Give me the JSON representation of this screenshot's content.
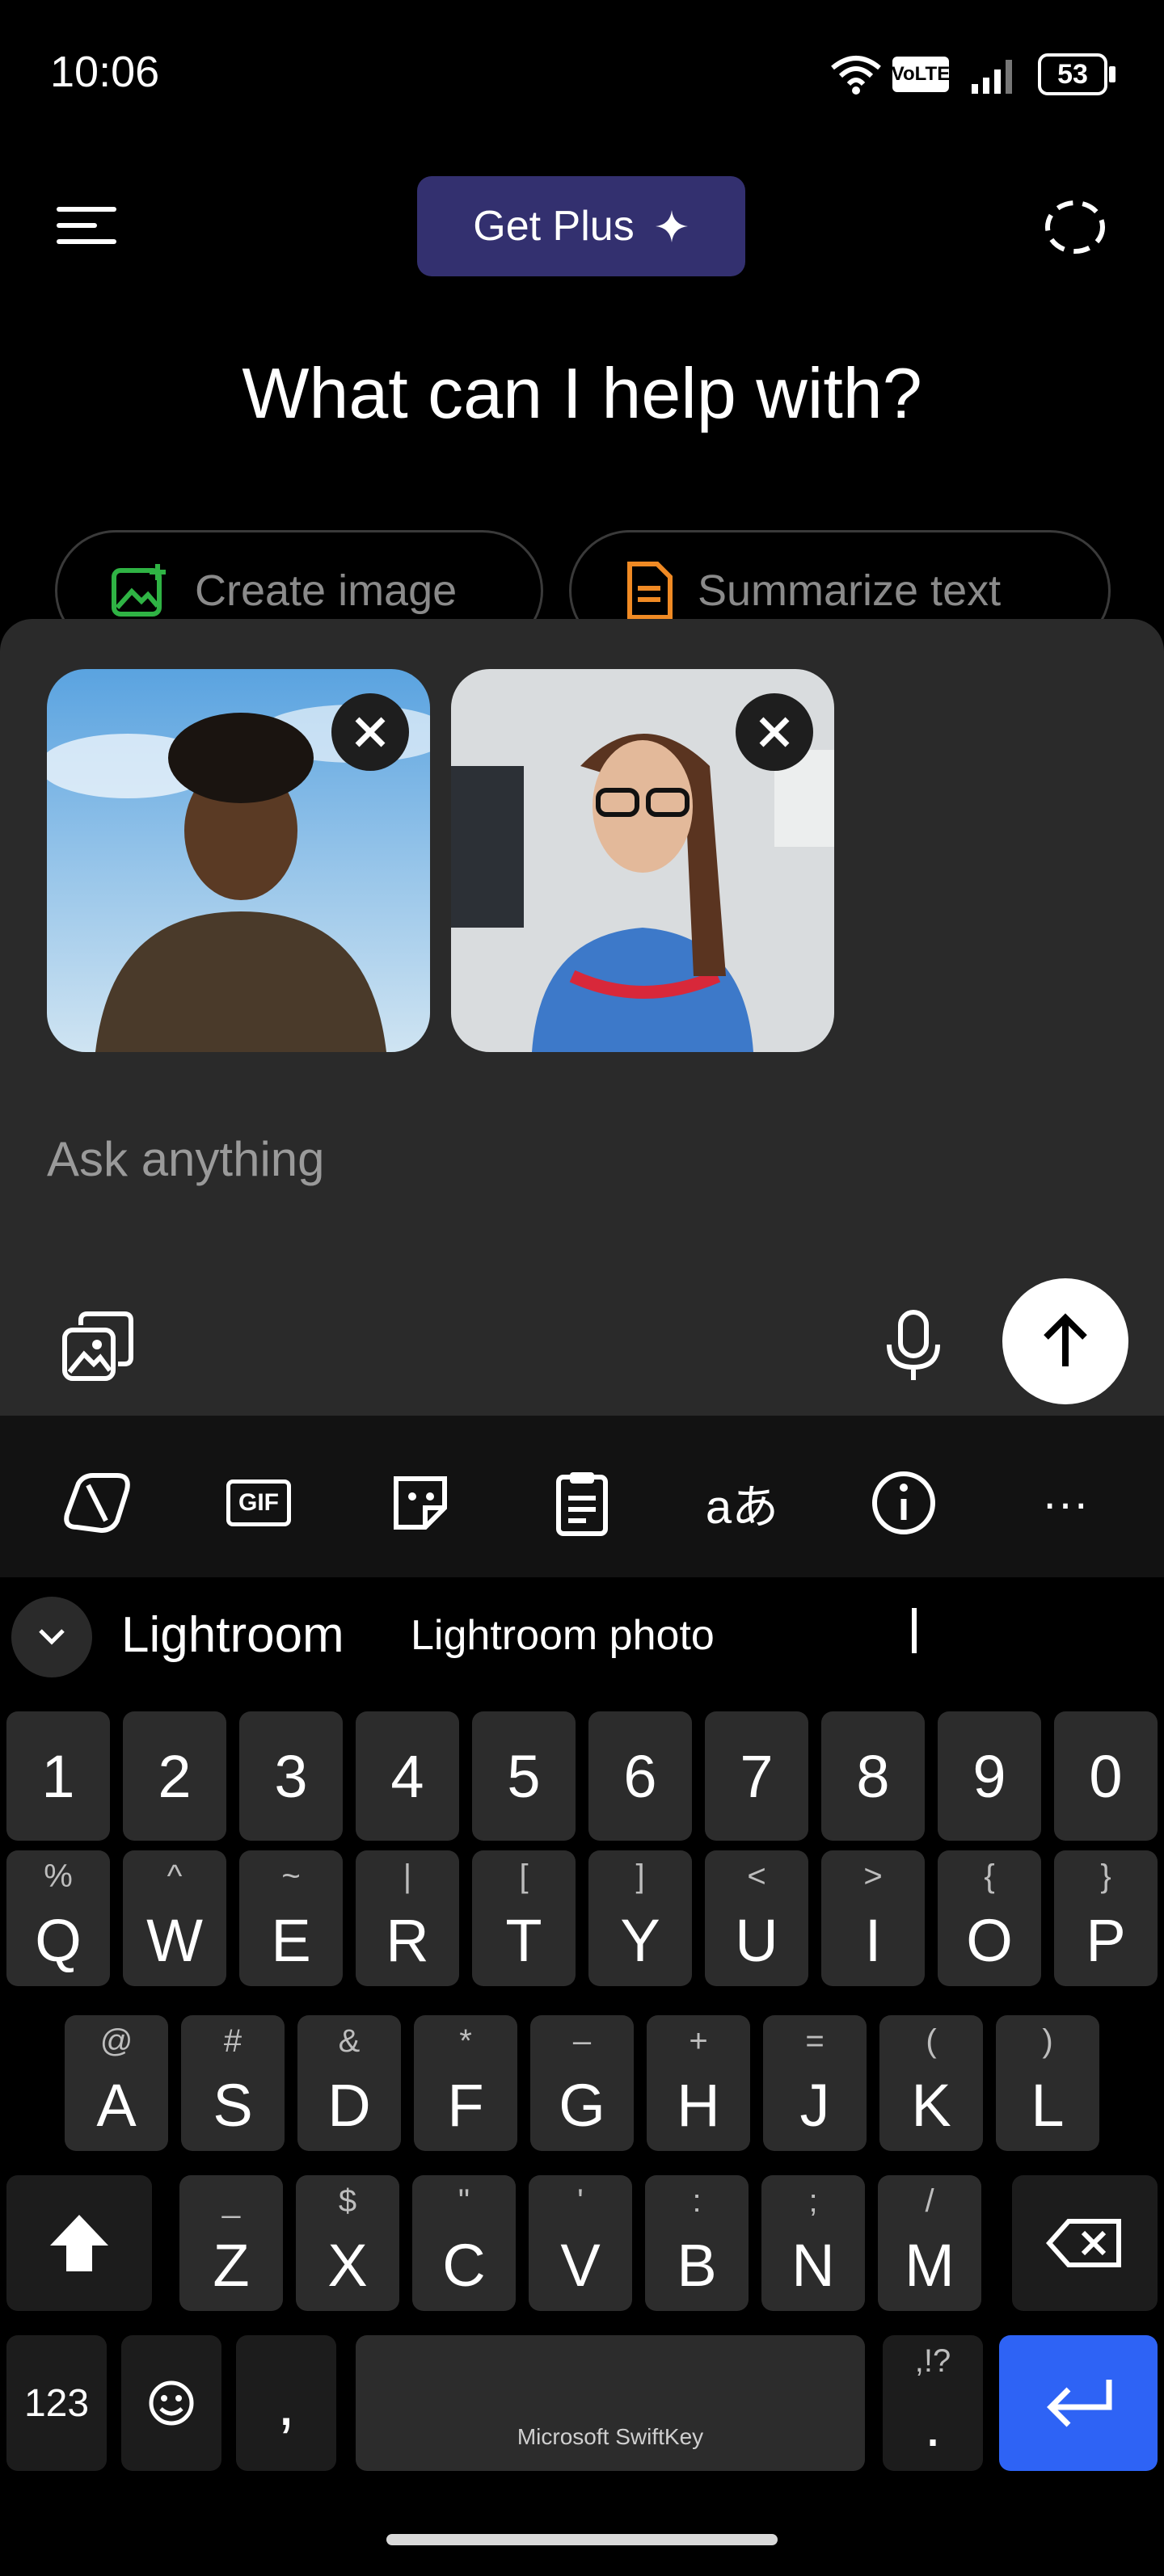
{
  "status_bar": {
    "time": "10:06",
    "volte": "VoLTE",
    "battery": "53",
    "icons": [
      "wifi-icon",
      "signal-icon",
      "battery-icon"
    ]
  },
  "top_bar": {
    "get_plus_label": "Get Plus",
    "icons": [
      "menu-icon",
      "sparkle-icon",
      "temporary-chat-icon"
    ]
  },
  "headline": "What can I help with?",
  "chips": [
    {
      "label": "Create image",
      "icon": "create-image-icon",
      "color": "#2fb344"
    },
    {
      "label": "Summarize text",
      "icon": "document-icon",
      "color": "#f08a24"
    }
  ],
  "composer": {
    "placeholder": "Ask anything",
    "attachments": [
      "photo-1",
      "photo-2"
    ],
    "icons": [
      "attach-image-icon",
      "microphone-icon",
      "send-arrow-icon"
    ]
  },
  "keyboard_toolbar": {
    "icons": [
      "copilot-icon",
      "gif-icon",
      "sticker-icon",
      "clipboard-icon",
      "translate-icon",
      "info-icon",
      "more-icon"
    ],
    "gif_label": "GIF"
  },
  "suggestions": [
    "Lightroom",
    "Lightroom photo"
  ],
  "keyboard": {
    "numbers": [
      "1",
      "2",
      "3",
      "4",
      "5",
      "6",
      "7",
      "8",
      "9",
      "0"
    ],
    "row1": [
      [
        "Q",
        "%"
      ],
      [
        "W",
        "^"
      ],
      [
        "E",
        "~"
      ],
      [
        "R",
        "|"
      ],
      [
        "T",
        "["
      ],
      [
        "Y",
        "]"
      ],
      [
        "U",
        "<"
      ],
      [
        "I",
        ">"
      ],
      [
        "O",
        "{"
      ],
      [
        "P",
        "}"
      ]
    ],
    "row2": [
      [
        "A",
        "@"
      ],
      [
        "S",
        "#"
      ],
      [
        "D",
        "&"
      ],
      [
        "F",
        "*"
      ],
      [
        "G",
        "–"
      ],
      [
        "H",
        "+"
      ],
      [
        "J",
        "="
      ],
      [
        "K",
        "("
      ],
      [
        "L",
        ")"
      ]
    ],
    "row3": [
      [
        "Z",
        "_"
      ],
      [
        "X",
        "$"
      ],
      [
        "C",
        "\""
      ],
      [
        "V",
        "'"
      ],
      [
        "B",
        ":"
      ],
      [
        "N",
        ";"
      ],
      [
        "M",
        "/"
      ]
    ],
    "bottom": {
      "numbers_label": "123",
      "comma": ",",
      "space_label": "Microsoft SwiftKey",
      "period": ".",
      "period_secondary": ",!?"
    },
    "enter_color": "#2e63f5"
  }
}
